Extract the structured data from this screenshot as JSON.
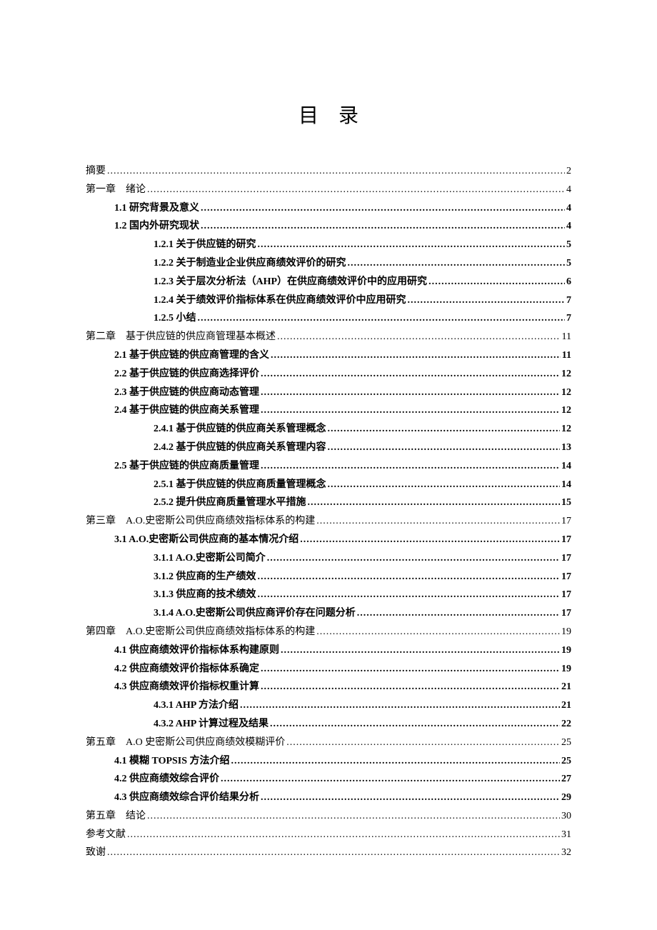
{
  "title": "目录",
  "entries": [
    {
      "label": "摘要",
      "page": "2",
      "level": 0
    },
    {
      "label": "第一章",
      "suffix": "绪论",
      "page": "4",
      "level": 0,
      "chapter": true
    },
    {
      "label": "1.1  研究背景及意义",
      "page": "4",
      "level": 1
    },
    {
      "label": "1.2  国内外研究现状",
      "page": "4",
      "level": 1
    },
    {
      "label": "1.2.1 关于供应链的研究",
      "page": "5",
      "level": 2
    },
    {
      "label": "1.2.2 关于制造业企业供应商绩效评价的研究",
      "page": "5",
      "level": 2
    },
    {
      "label": "1.2.3 关于层次分析法（AHP）在供应商绩效评价中的应用研究",
      "page": "6",
      "level": 2
    },
    {
      "label": "1.2.4 关于绩效评价指标体系在供应商绩效评价中应用研究",
      "page": "7",
      "level": 2
    },
    {
      "label": "1.2.5 小结",
      "page": "7",
      "level": 2
    },
    {
      "label": "第二章",
      "suffix": "基于供应链的供应商管理基本概述",
      "page": "11",
      "level": 0,
      "chapter": true
    },
    {
      "label": "2.1  基于供应链的供应商管理的含义",
      "page": "11",
      "level": 1
    },
    {
      "label": "2.2  基于供应链的供应商选择评价",
      "page": "12",
      "level": 1
    },
    {
      "label": "2.3  基于供应链的供应商动态管理",
      "page": "12",
      "level": 1
    },
    {
      "label": "2.4  基于供应链的供应商关系管理",
      "page": "12",
      "level": 1
    },
    {
      "label": "2.4.1 基于供应链的供应商关系管理概念",
      "page": "12",
      "level": 2
    },
    {
      "label": "2.4.2 基于供应链的供应商关系管理内容",
      "page": "13",
      "level": 2
    },
    {
      "label": "2.5  基于供应链的供应商质量管理",
      "page": "14",
      "level": 1
    },
    {
      "label": "2.5.1 基于供应链的供应商质量管理概念",
      "page": "14",
      "level": 2
    },
    {
      "label": "2.5.2 提升供应商质量管理水平措施",
      "page": "15",
      "level": 2
    },
    {
      "label": "第三章",
      "suffix": "A.O.史密斯公司供应商绩效指标体系的构建",
      "page": "17",
      "level": 0,
      "chapter": true
    },
    {
      "label": "3.1  A.O.史密斯公司供应商的基本情况介绍",
      "page": "17",
      "level": 1
    },
    {
      "label": "3.1.1 A.O.史密斯公司简介",
      "page": "17",
      "level": 2
    },
    {
      "label": "3.1.2  供应商的生产绩效",
      "page": "17",
      "level": 2
    },
    {
      "label": "3.1.3  供应商的技术绩效",
      "page": "17",
      "level": 2
    },
    {
      "label": "3.1.4 A.O.史密斯公司供应商评价存在问题分析",
      "page": "17",
      "level": 2
    },
    {
      "label": "第四章",
      "suffix": "A.O.史密斯公司供应商绩效指标体系的构建",
      "page": "19",
      "level": 0,
      "chapter": true
    },
    {
      "label": "4.1  供应商绩效评价指标体系构建原则",
      "page": "19",
      "level": 1
    },
    {
      "label": "4.2  供应商绩效评价指标体系确定",
      "page": "19",
      "level": 1
    },
    {
      "label": "4.3  供应商绩效评价指标权重计算",
      "page": "21",
      "level": 1
    },
    {
      "label": "4.3.1 AHP 方法介绍",
      "page": "21",
      "level": 2
    },
    {
      "label": "4.3.2 AHP 计算过程及结果",
      "page": "22",
      "level": 2
    },
    {
      "label": "第五章",
      "suffix": "A.O 史密斯公司供应商绩效模糊评价",
      "page": "25",
      "level": 0,
      "chapter": true
    },
    {
      "label": "4.1  模糊 TOPSIS 方法介绍",
      "page": "25",
      "level": 1
    },
    {
      "label": "4.2  供应商绩效综合评价",
      "page": "27",
      "level": 1
    },
    {
      "label": "4.3  供应商绩效综合评价结果分析",
      "page": "29",
      "level": 1
    },
    {
      "label": "第五章",
      "suffix": "结论",
      "page": "30",
      "level": 0,
      "chapter": true
    },
    {
      "label": "参考文献",
      "page": "31",
      "level": 0
    },
    {
      "label": "致谢",
      "page": "32",
      "level": 0
    }
  ]
}
